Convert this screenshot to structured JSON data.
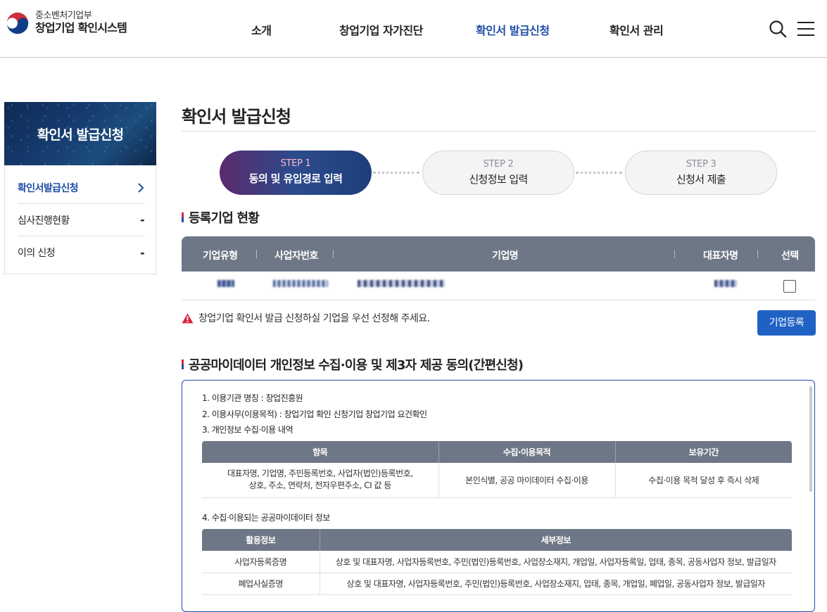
{
  "header": {
    "ministry": "중소벤처기업부",
    "system_name": "창업기업 확인시스템",
    "nav": [
      {
        "label": "소개"
      },
      {
        "label": "창업기업 자가진단"
      },
      {
        "label": "확인서 발급신청"
      },
      {
        "label": "확인서 관리"
      }
    ],
    "active_nav_index": 2
  },
  "sidebar": {
    "banner_title": "확인서 발급신청",
    "items": [
      {
        "label": "확인서발급신청",
        "mark": "›",
        "active": true
      },
      {
        "label": "심사진행현황",
        "mark": "-"
      },
      {
        "label": "이의 신청",
        "mark": "-"
      }
    ]
  },
  "main": {
    "page_title": "확인서 발급신청",
    "steps": [
      {
        "num": "STEP 1",
        "label": "동의 및 유입경로 입력",
        "active": true
      },
      {
        "num": "STEP 2",
        "label": "신청정보 입력",
        "active": false
      },
      {
        "num": "STEP 3",
        "label": "신청서 제출",
        "active": false
      }
    ],
    "registered": {
      "heading": "등록기업 현황",
      "columns": [
        "기업유형",
        "사업자번호",
        "기업명",
        "대표자명",
        "선택"
      ],
      "row_checked": false
    },
    "warning_text": "창업기업 확인서 발급 신청하실 기업을 우선 선정해 주세요.",
    "register_button": "기업등록",
    "consent": {
      "heading": "공공마이데이터 개인정보 수집·이용 및 제3자 제공 동의(간편신청)",
      "line1": "1. 이용기관 명칭 : 창업진흥원",
      "line2": "2. 이용사무(이용목적) : 창업기업 확인 신청기업 창업기업 요건확인",
      "line3": "3. 개인정보 수집·이용 내역",
      "table1": {
        "headers": [
          "항목",
          "수집·이용목적",
          "보유기간"
        ],
        "cell1_line1": "대표자명, 기업명, 주민등록번호, 사업자(법인)등록번호,",
        "cell1_line2": "상호, 주소, 연락처, 전자우편주소, CI 값 등",
        "cell2": "본인식별, 공공 마이데이터 수집·이용",
        "cell3": "수집·이용 목적 달성 후 즉시 삭제"
      },
      "line4": "4. 수집·이용되는 공공마이데이터 정보",
      "table2": {
        "headers": [
          "활용정보",
          "세부정보"
        ],
        "rows": [
          {
            "name": "사업자등록증명",
            "detail": "상호 및 대표자명, 사업자등록번호, 주민(법인)등록번호, 사업장소재지, 개업일, 사업자등록일, 업태, 종목, 공동사업자 정보, 발급일자"
          },
          {
            "name": "폐업사실증명",
            "detail": "상호 및 대표자명, 사업자등록번호, 주민(법인)등록번호, 사업장소재지, 업태, 종목, 개업일, 폐업일, 공동사업자 정보, 발급일자"
          }
        ]
      }
    }
  }
}
